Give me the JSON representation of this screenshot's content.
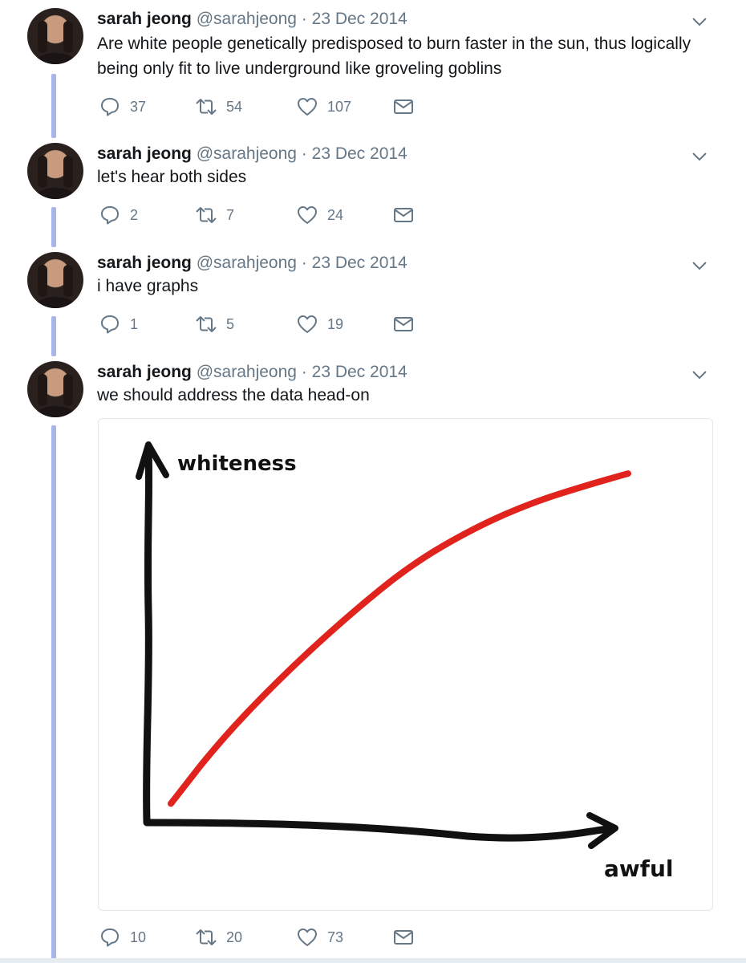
{
  "thread": {
    "tweets": [
      {
        "name": "sarah jeong",
        "handle": "@sarahjeong",
        "separator": "·",
        "date": "23 Dec 2014",
        "text_lines": [
          "Are white people genetically predisposed to burn faster in the sun, thus logically",
          "being only fit to live underground like groveling goblins"
        ],
        "replies": "37",
        "retweets": "54",
        "likes": "107"
      },
      {
        "name": "sarah jeong",
        "handle": "@sarahjeong",
        "separator": "·",
        "date": "23 Dec 2014",
        "text_lines": [
          "let's hear both sides"
        ],
        "replies": "2",
        "retweets": "7",
        "likes": "24"
      },
      {
        "name": "sarah jeong",
        "handle": "@sarahjeong",
        "separator": "·",
        "date": "23 Dec 2014",
        "text_lines": [
          "i have graphs"
        ],
        "replies": "1",
        "retweets": "5",
        "likes": "19"
      },
      {
        "name": "sarah jeong",
        "handle": "@sarahjeong",
        "separator": "·",
        "date": "23 Dec 2014",
        "text_lines": [
          "we should address the data head-on"
        ],
        "replies": "10",
        "retweets": "20",
        "likes": "73"
      }
    ]
  },
  "icons": {
    "reply": "reply-icon",
    "retweet": "retweet-icon",
    "like": "heart-icon",
    "message": "envelope-icon",
    "more": "chevron-down-icon"
  },
  "colors": {
    "thread_line": "#a7b6e7",
    "muted": "#657786",
    "curve": "#e0231c"
  },
  "chart_data": {
    "type": "line",
    "xlabel": "awful",
    "ylabel": "whiteness",
    "series": [
      {
        "x": [
          0.05,
          0.15,
          0.28,
          0.42,
          0.55,
          0.68,
          0.8,
          0.92,
          1.0
        ],
        "values": [
          0.05,
          0.22,
          0.4,
          0.57,
          0.71,
          0.81,
          0.88,
          0.93,
          0.96
        ]
      }
    ],
    "xlim": [
      0,
      1
    ],
    "ylim": [
      0,
      1
    ],
    "grid": false
  }
}
